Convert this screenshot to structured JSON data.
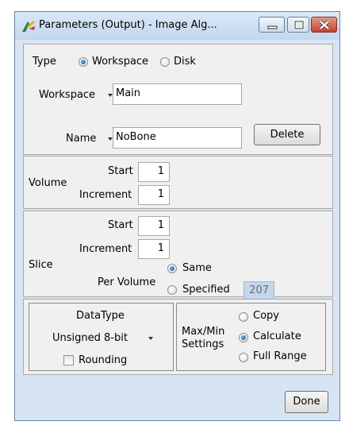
{
  "window": {
    "title": "Parameters (Output) - Image Alg..."
  },
  "type_section": {
    "label": "Type",
    "options": [
      "Workspace",
      "Disk"
    ],
    "selected": "Workspace",
    "workspace_label": "Workspace",
    "workspace_value": "Main",
    "name_label": "Name",
    "name_value": "NoBone",
    "delete_label": "Delete"
  },
  "volume_section": {
    "label": "Volume",
    "start_label": "Start",
    "start_value": "1",
    "increment_label": "Increment",
    "increment_value": "1"
  },
  "slice_section": {
    "label": "Slice",
    "start_label": "Start",
    "start_value": "1",
    "increment_label": "Increment",
    "increment_value": "1",
    "per_volume_label": "Per Volume",
    "per_volume_options": [
      "Same",
      "Specified"
    ],
    "per_volume_selected": "Same",
    "specified_value": "207"
  },
  "datatype_section": {
    "label": "DataType",
    "value": "Unsigned 8-bit",
    "rounding_label": "Rounding",
    "rounding_checked": false
  },
  "maxmin_section": {
    "label_line1": "Max/Min",
    "label_line2": "Settings",
    "options": [
      "Copy",
      "Calculate",
      "Full Range"
    ],
    "selected": "Calculate"
  },
  "footer": {
    "done_label": "Done"
  },
  "colors": {
    "window_frame": "#d6e4f4",
    "panel_bg": "#f0f0f0",
    "radio_selected": "#1d5ab0",
    "close_button": "#c9402c",
    "disabled_field": "#c4d6ec"
  }
}
